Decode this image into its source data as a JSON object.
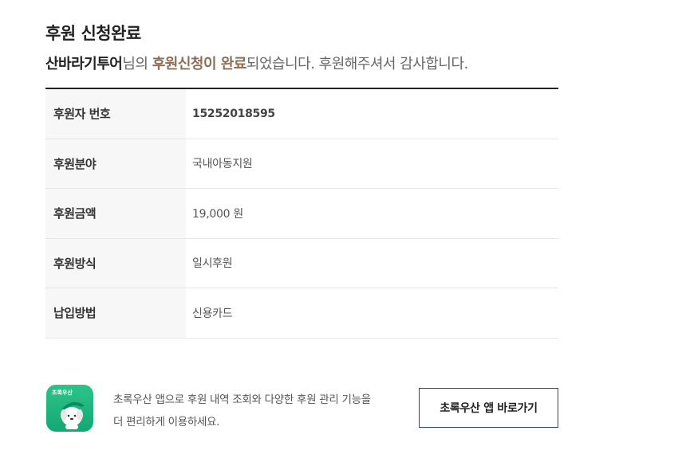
{
  "title": "후원 신청완료",
  "message": {
    "name": "산바라기투어",
    "part1": "님의 ",
    "accent": "후원신청이 완료",
    "part2": "되었습니다. 후원해주셔서 감사합니다."
  },
  "rows": [
    {
      "label": "후원자 번호",
      "value": "15252018595"
    },
    {
      "label": "후원분야",
      "value": "국내아동지원"
    },
    {
      "label": "후원금액",
      "value": "19,000 원"
    },
    {
      "label": "후원방식",
      "value": "일시후원"
    },
    {
      "label": "납입방법",
      "value": "신용카드"
    }
  ],
  "app": {
    "icon_brand": "초록우산",
    "icon": "mascot-app-icon",
    "promo_line1": "초록우산 앱으로 후원 내역 조회와 다양한 후원 관리 기능을",
    "promo_line2": "더 편리하게 이용하세요.",
    "button_label": "초록우산 앱 바로가기"
  },
  "colors": {
    "accent": "#8c6e55",
    "brand_green": "#16a774",
    "button_border": "#0e5c46"
  }
}
